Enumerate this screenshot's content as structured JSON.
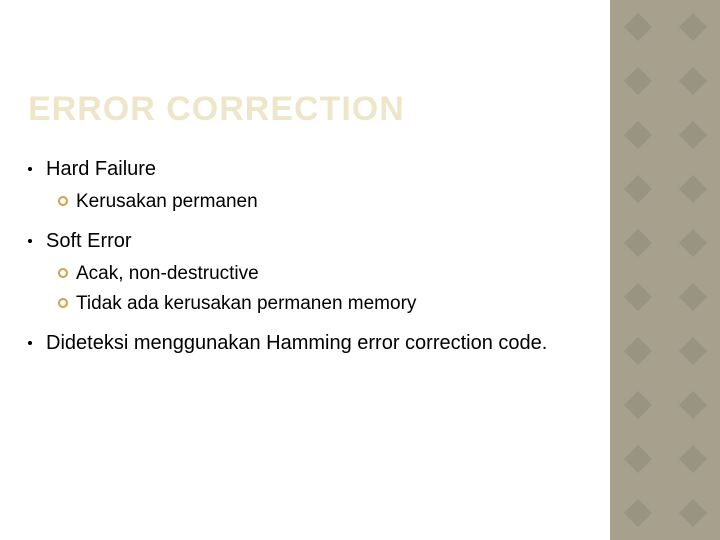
{
  "title": "ERROR CORRECTION",
  "items": [
    {
      "label": "Hard Failure",
      "sub": [
        "Kerusakan permanen"
      ]
    },
    {
      "label": "Soft Error",
      "sub": [
        "Acak, non-destructive",
        "Tidak ada kerusakan permanen memory"
      ]
    },
    {
      "label": "Dideteksi menggunakan Hamming error correction code.",
      "sub": []
    }
  ]
}
